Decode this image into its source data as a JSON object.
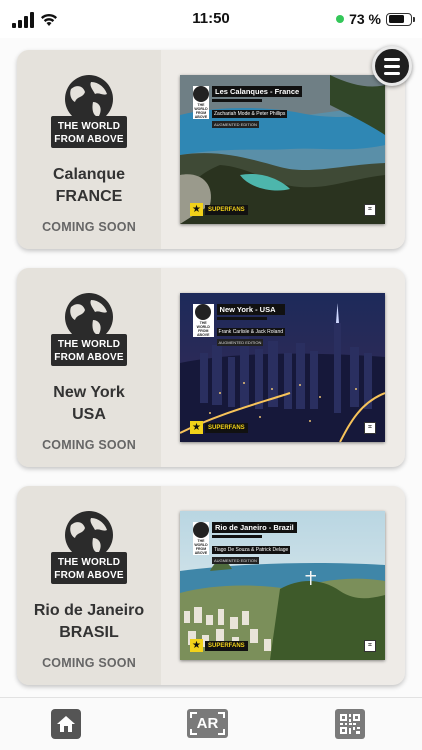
{
  "status_bar": {
    "time": "11:50",
    "battery_percent": "73 %",
    "battery_level": 0.73
  },
  "logo": {
    "line1": "THE WORLD",
    "line2": "FROM ABOVE"
  },
  "cards": [
    {
      "place_line1": "Calanque",
      "place_line2": "FRANCE",
      "status": "COMING SOON",
      "cover_title": "Les Calanques - France",
      "cover_authors": "Zachariah Mode & Peter Phillips",
      "cover_edition": "AUGMENTED EDITION",
      "superfans": "SUPERFANS"
    },
    {
      "place_line1": "New York",
      "place_line2": "USA",
      "status": "COMING SOON",
      "cover_title": "New York - USA",
      "cover_authors": "Frank Carlisle & Jack Roland",
      "cover_edition": "AUGMENTED EDITION",
      "superfans": "SUPERFANS"
    },
    {
      "place_line1": "Rio de Janeiro",
      "place_line2": "BRASIL",
      "status": "COMING SOON",
      "cover_title": "Rio de Janeiro - Brazil",
      "cover_authors": "Tiago De Souza & Patrick Delage",
      "cover_edition": "AUGMENTED EDITION",
      "superfans": "SUPERFANS"
    }
  ],
  "tabbar": {
    "ar_label": "AR"
  },
  "icons": {
    "menu": "hamburger-menu-icon",
    "home": "home-icon",
    "ar": "ar-icon",
    "qr": "qr-code-icon",
    "globe": "globe-icon",
    "star": "star-icon"
  },
  "colors": {
    "card_bg": "#eeebe7",
    "card_left_bg": "#e5e2dc",
    "status_dot": "#34c759",
    "superfans_yellow": "#f2d21a"
  }
}
